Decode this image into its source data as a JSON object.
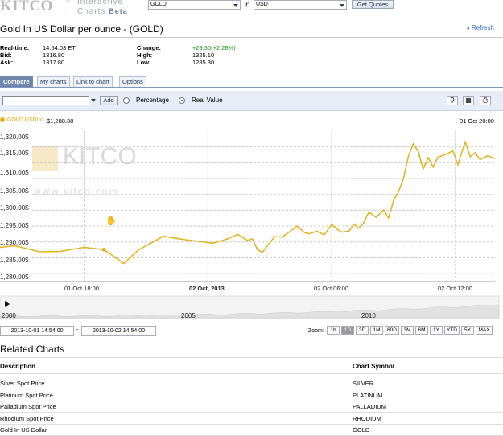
{
  "header": {
    "logo_text": "KITCO",
    "logo_reg": "®",
    "logo_line1": "Interactive",
    "logo_line2": "Charts",
    "logo_beta": "Beta",
    "symbol_value": "GOLD",
    "in_label": "in",
    "currency_value": "USD",
    "get_quotes": "Get Quotes"
  },
  "title": "Gold In US Dollar per ounce - (GOLD)",
  "refresh": "Refresh",
  "quote": {
    "left": [
      {
        "label": "Real-time:",
        "value": "14:54:03 ET"
      },
      {
        "label": "Bid:",
        "value": "1316.80"
      },
      {
        "label": "Ask:",
        "value": "1317.80"
      }
    ],
    "right": [
      {
        "label": "Change:",
        "value": "+29.30(+2.28%)"
      },
      {
        "label": "High:",
        "value": "1325.10"
      },
      {
        "label": "Low:",
        "value": "1285.30"
      }
    ],
    "change_color": "#1a9a1a"
  },
  "tabs": [
    "Compare",
    "My charts",
    "Link to chart",
    "Options"
  ],
  "toolbar": {
    "add_label": "Add",
    "percentage_label": "Percentage",
    "real_value_label": "Real Value",
    "zoom_icon": "magnifier-icon",
    "save_icon": "floppy-icon",
    "print_icon": "printer-icon"
  },
  "legend": {
    "name": "GOLD USD/oz",
    "value": "$1,288.30",
    "date": "01 Oct 20:00",
    "color": "#e3b21b"
  },
  "watermark": {
    "brand": "KITCO",
    "reg": "®",
    "url": "www.kitco.com"
  },
  "chart_data": {
    "type": "line",
    "series": [
      {
        "name": "GOLD USD/oz",
        "color": "#e3b21b"
      }
    ],
    "y_tick_labels": [
      "1,320.00$",
      "1,315.00$",
      "1,310.00$",
      "1,305.00$",
      "1,300.00$",
      "1,295.00$",
      "1,290.00$",
      "1,285.00$",
      "1,280.00$"
    ],
    "y_ticks": [
      1320,
      1315,
      1310,
      1305,
      1300,
      1295,
      1290,
      1285,
      1280
    ],
    "ylim": [
      1277.5,
      1325
    ],
    "x_tick_labels": [
      {
        "label": "01 Oct 18:00",
        "bold": false,
        "t": 0.17
      },
      {
        "label": "02 Oct, 2013",
        "bold": true,
        "t": 0.42
      },
      {
        "label": "02 Oct 06:00",
        "bold": false,
        "t": 0.67
      },
      {
        "label": "02 Oct 12:00",
        "bold": false,
        "t": 0.92
      }
    ],
    "points": [
      [
        0.0,
        1288.3
      ],
      [
        0.03,
        1288.8
      ],
      [
        0.08,
        1286.9
      ],
      [
        0.12,
        1287.0
      ],
      [
        0.17,
        1288.3
      ],
      [
        0.21,
        1287.6
      ],
      [
        0.25,
        1283.2
      ],
      [
        0.28,
        1287.5
      ],
      [
        0.33,
        1291.8
      ],
      [
        0.37,
        1290.8
      ],
      [
        0.41,
        1290.0
      ],
      [
        0.43,
        1289.6
      ],
      [
        0.46,
        1291.0
      ],
      [
        0.48,
        1292.4
      ],
      [
        0.5,
        1290.5
      ],
      [
        0.51,
        1291.0
      ],
      [
        0.52,
        1287.6
      ],
      [
        0.53,
        1286.7
      ],
      [
        0.545,
        1289.8
      ],
      [
        0.555,
        1291.7
      ],
      [
        0.57,
        1291.5
      ],
      [
        0.585,
        1293.2
      ],
      [
        0.6,
        1295.0
      ],
      [
        0.615,
        1293.0
      ],
      [
        0.625,
        1292.6
      ],
      [
        0.64,
        1293.4
      ],
      [
        0.655,
        1292.2
      ],
      [
        0.67,
        1295.5
      ],
      [
        0.68,
        1294.2
      ],
      [
        0.69,
        1293.1
      ],
      [
        0.705,
        1293.4
      ],
      [
        0.715,
        1295.6
      ],
      [
        0.725,
        1294.3
      ],
      [
        0.735,
        1296.0
      ],
      [
        0.745,
        1299.4
      ],
      [
        0.76,
        1297.8
      ],
      [
        0.775,
        1300.1
      ],
      [
        0.785,
        1297.6
      ],
      [
        0.795,
        1303.0
      ],
      [
        0.805,
        1305.8
      ],
      [
        0.815,
        1309.9
      ],
      [
        0.825,
        1317.0
      ],
      [
        0.835,
        1321.0
      ],
      [
        0.845,
        1318.5
      ],
      [
        0.855,
        1313.0
      ],
      [
        0.865,
        1316.6
      ],
      [
        0.875,
        1313.7
      ],
      [
        0.885,
        1316.8
      ],
      [
        0.9,
        1317.6
      ],
      [
        0.915,
        1318.7
      ],
      [
        0.925,
        1314.4
      ],
      [
        0.94,
        1321.6
      ],
      [
        0.95,
        1316.9
      ],
      [
        0.96,
        1318.2
      ],
      [
        0.97,
        1316.0
      ],
      [
        0.985,
        1317.2
      ],
      [
        1.0,
        1316.3
      ]
    ],
    "marker_t": 0.21,
    "navigator": {
      "labels": [
        "2000",
        "2005",
        "2010"
      ]
    }
  },
  "range": {
    "from": "2013-10-01 14:54:00",
    "to": "2013-10-02 14:54:00",
    "zoom_label": "Zoom:",
    "zoom_buttons": [
      "1h",
      "1D",
      "3D",
      "1M",
      "60D",
      "3M",
      "6M",
      "1Y",
      "YTD",
      "5Y",
      "MAX"
    ],
    "zoom_selected": "1D"
  },
  "related": {
    "title": "Related Charts",
    "col_description": "Description",
    "col_symbol": "Chart Symbol",
    "rows": [
      {
        "description": "Silver Spot Price",
        "symbol": "SILVER"
      },
      {
        "description": "Platinum Spot Price",
        "symbol": "PLATINUM"
      },
      {
        "description": "Palladium Spot Price",
        "symbol": "PALLADIUM"
      },
      {
        "description": "Rhodium Spot Price",
        "symbol": "RHODIUM"
      },
      {
        "description": "Gold In US Dollar",
        "symbol": "GOLD"
      }
    ]
  }
}
